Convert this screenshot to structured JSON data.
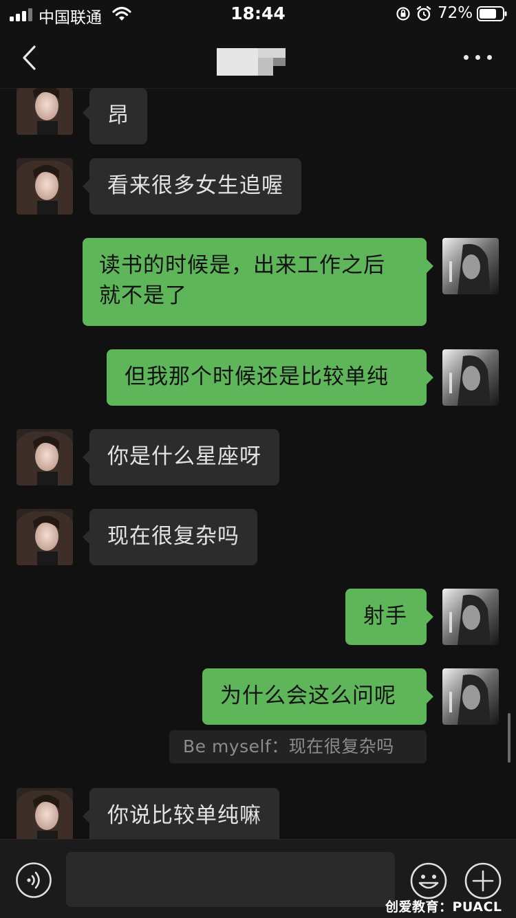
{
  "status_bar": {
    "carrier": "中国联通",
    "time": "18:44",
    "battery_percent": "72%"
  },
  "header": {
    "back_icon": "chevron-left-icon",
    "more_icon": "more-dots-icon"
  },
  "messages": [
    {
      "side": "in",
      "text": "昂"
    },
    {
      "side": "in",
      "text": "看来很多女生追喔"
    },
    {
      "side": "out",
      "lines": [
        "读书的时候是，出来工作之后",
        "就不是了"
      ]
    },
    {
      "side": "out",
      "text": "但我那个时候还是比较单纯"
    },
    {
      "side": "in",
      "text": "你是什么星座呀"
    },
    {
      "side": "in",
      "text": "现在很复杂吗"
    },
    {
      "side": "out",
      "text": "射手"
    },
    {
      "side": "out",
      "text": "为什么会这么问呢",
      "quote": "Be myself：现在很复杂吗"
    },
    {
      "side": "in",
      "text": "你说比较单纯嘛"
    }
  ],
  "input_bar": {
    "voice_icon": "voice-icon",
    "emoji_icon": "emoji-icon",
    "plus_icon": "plus-icon"
  },
  "watermark": "创爱教育：PUACL"
}
